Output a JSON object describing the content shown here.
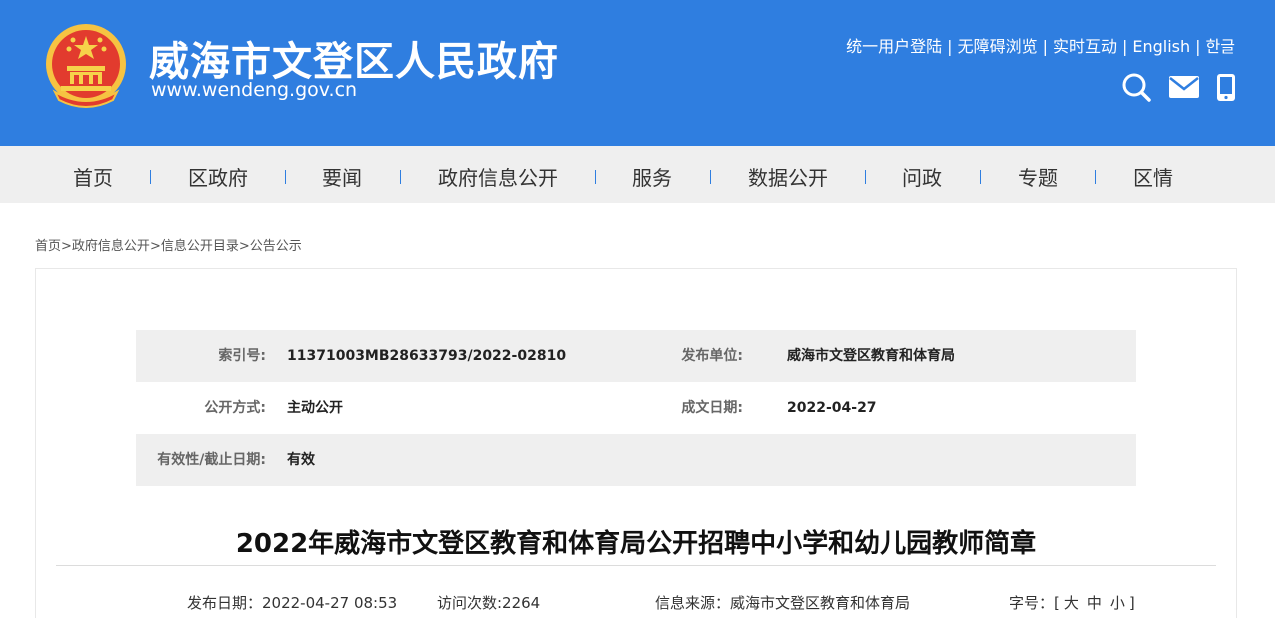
{
  "header": {
    "title": "威海市文登区人民政府",
    "url": "www.wendeng.gov.cn",
    "links": [
      "统一用户登陆",
      "无障碍浏览",
      "实时互动",
      "English",
      "한글"
    ],
    "separator": "|",
    "icons": [
      "search-icon",
      "mail-icon",
      "mobile-icon"
    ],
    "bg_color": "#2f7ee0"
  },
  "nav": {
    "items": [
      "首页",
      "区政府",
      "要闻",
      "政府信息公开",
      "服务",
      "数据公开",
      "问政",
      "专题",
      "区情"
    ],
    "separator_color": "#2f7ee0"
  },
  "breadcrumb": {
    "items": [
      "首页",
      "政府信息公开",
      "信息公开目录",
      "公告公示"
    ],
    "separator": ">"
  },
  "meta": {
    "index_label": "索引号:",
    "index_value": "11371003MB28633793/2022-02810",
    "publisher_label": "发布单位:",
    "publisher_value": "威海市文登区教育和体育局",
    "open_label": "公开方式:",
    "open_value": "主动公开",
    "date_label": "成文日期:",
    "date_value": "2022-04-27",
    "validity_label": "有效性/截止日期:",
    "validity_value": "有效"
  },
  "article": {
    "title": "2022年威海市文登区教育和体育局公开招聘中小学和幼儿园教师简章",
    "publish_date": "发布日期：2022-04-27 08:53",
    "visits": "访问次数:2264",
    "source": "信息来源：威海市文登区教育和体育局",
    "font_size_label": "字号：[",
    "font_size_large": "大",
    "font_size_medium": "中",
    "font_size_small": "小",
    "font_size_close": "]"
  }
}
